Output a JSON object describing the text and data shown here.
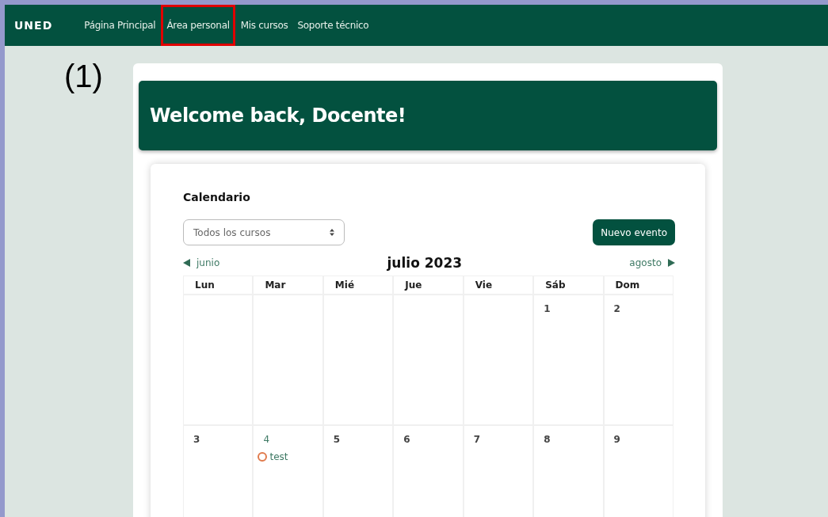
{
  "navbar": {
    "logo": "UNED",
    "items": [
      {
        "label": "Página Principal",
        "highlighted": false
      },
      {
        "label": "Área personal",
        "highlighted": true
      },
      {
        "label": "Mis cursos",
        "highlighted": false
      },
      {
        "label": "Soporte técnico",
        "highlighted": false
      }
    ]
  },
  "step_label": "(1)",
  "welcome": {
    "title": "Welcome back, Docente!"
  },
  "calendar": {
    "title": "Calendario",
    "course_select": {
      "value": "Todos los cursos"
    },
    "new_event_button": "Nuevo evento",
    "prev_month": "junio",
    "month": "julio 2023",
    "next_month": "agosto",
    "weekdays": [
      "Lun",
      "Mar",
      "Mié",
      "Jue",
      "Vie",
      "Sáb",
      "Dom"
    ],
    "weeks": [
      [
        {
          "day": "1",
          "has_events": false
        },
        {
          "day": "2",
          "has_events": false
        }
      ],
      [
        {
          "day": "3",
          "has_events": false
        },
        {
          "day": "4",
          "has_events": true,
          "events": [
            {
              "name": "test",
              "color": "#e07a4c"
            }
          ]
        },
        {
          "day": "5",
          "has_events": false
        },
        {
          "day": "6",
          "has_events": false
        },
        {
          "day": "7",
          "has_events": false
        },
        {
          "day": "8",
          "has_events": false
        },
        {
          "day": "9",
          "has_events": false
        }
      ]
    ]
  }
}
